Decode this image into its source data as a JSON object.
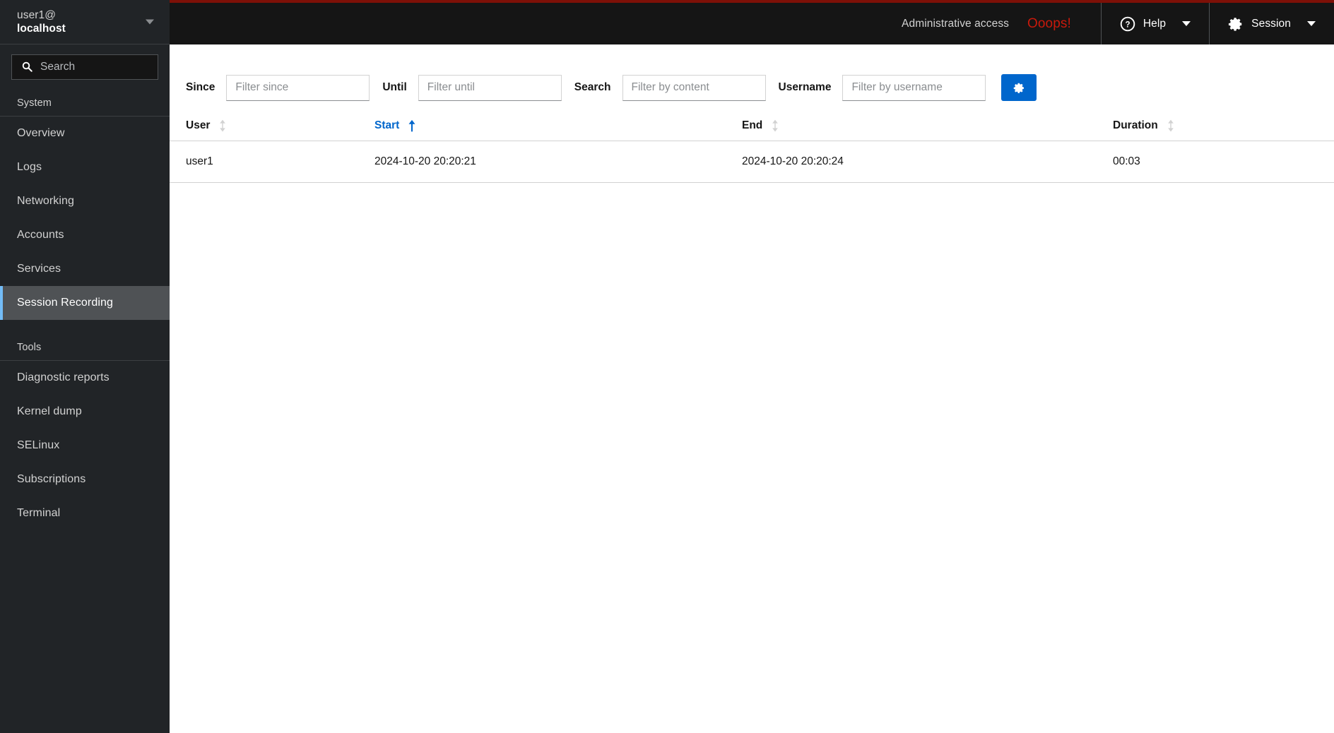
{
  "sidebar": {
    "host": {
      "user": "user1@",
      "machine": "localhost",
      "caret_icon": "chevron-down-icon"
    },
    "search": {
      "placeholder": "Search",
      "value": "",
      "icon": "search-icon"
    },
    "groups": [
      {
        "title": "System",
        "items": [
          {
            "label": "Overview",
            "selected": false
          },
          {
            "label": "Logs",
            "selected": false
          },
          {
            "label": "Networking",
            "selected": false
          },
          {
            "label": "Accounts",
            "selected": false
          },
          {
            "label": "Services",
            "selected": false
          },
          {
            "label": "Session Recording",
            "selected": true
          }
        ]
      },
      {
        "title": "Tools",
        "items": [
          {
            "label": "Diagnostic reports",
            "selected": false
          },
          {
            "label": "Kernel dump",
            "selected": false
          },
          {
            "label": "SELinux",
            "selected": false
          },
          {
            "label": "Subscriptions",
            "selected": false
          },
          {
            "label": "Terminal",
            "selected": false
          }
        ]
      }
    ]
  },
  "topbar": {
    "admin_access": "Administrative access",
    "oops": "Ooops!",
    "help_label": "Help",
    "help_icon": "question-circle-icon",
    "session_label": "Session",
    "session_icon": "gear-icon",
    "caret_icon": "caret-down-icon",
    "accent_border": "#7d1007",
    "oops_color": "#c9190b",
    "background": "#151515"
  },
  "toolbar": {
    "since": {
      "label": "Since",
      "placeholder": "Filter since",
      "value": ""
    },
    "until": {
      "label": "Until",
      "placeholder": "Filter until",
      "value": ""
    },
    "search": {
      "label": "Search",
      "placeholder": "Filter by content",
      "value": ""
    },
    "username": {
      "label": "Username",
      "placeholder": "Filter by username",
      "value": ""
    },
    "settings_button": {
      "icon": "gear-icon",
      "color": "#0066cc",
      "label": ""
    }
  },
  "table": {
    "columns": [
      {
        "label": "User",
        "sort": "none",
        "sort_icon": "sort-both-icon"
      },
      {
        "label": "Start",
        "sort": "asc",
        "sort_icon": "sort-asc-icon"
      },
      {
        "label": "End",
        "sort": "none",
        "sort_icon": "sort-both-icon"
      },
      {
        "label": "Duration",
        "sort": "none",
        "sort_icon": "sort-both-icon"
      }
    ],
    "rows": [
      {
        "user": "user1",
        "start": "2024-10-20 20:20:21",
        "end": "2024-10-20 20:20:24",
        "duration": "00:03"
      }
    ]
  },
  "colors": {
    "sidebar_bg": "#212427",
    "sidebar_selected_bg": "#4f5255",
    "sidebar_selected_accent": "#73bcf7",
    "link_blue": "#0066cc",
    "border_gray": "#d2d2d2"
  }
}
